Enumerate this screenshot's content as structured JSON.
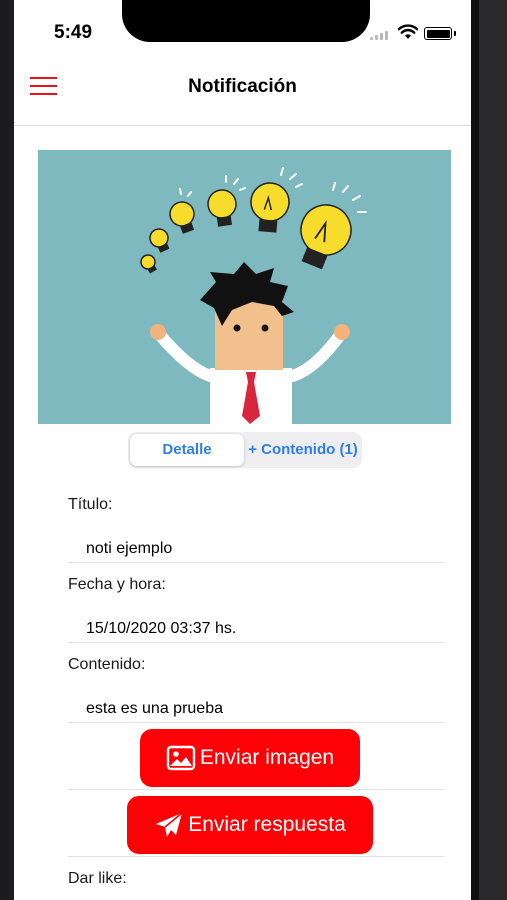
{
  "status_bar": {
    "time": "5:49"
  },
  "nav": {
    "title": "Notificación",
    "menu_icon": "hamburger-menu-icon"
  },
  "hero": {
    "alt": "Ilustración de hombre con bombillas de ideas"
  },
  "segmented": {
    "detail_label": "Detalle",
    "content_label": "+ Contenido (1)"
  },
  "form": {
    "title_label": "Título:",
    "title_value": "noti ejemplo",
    "date_label": "Fecha y hora:",
    "date_value": "15/10/2020 03:37 hs.",
    "content_label": "Contenido:",
    "content_value": "esta es una prueba",
    "like_label": "Dar like:"
  },
  "buttons": {
    "send_image_label": "Enviar imagen",
    "send_image_icon": "image-icon",
    "send_reply_label": "Enviar respuesta",
    "send_reply_icon": "paper-plane-icon"
  },
  "colors": {
    "accent": "#fc0206",
    "menu": "#e8121b",
    "segment_text": "#2f7fe0",
    "hero_bg": "#7fb9c0"
  }
}
